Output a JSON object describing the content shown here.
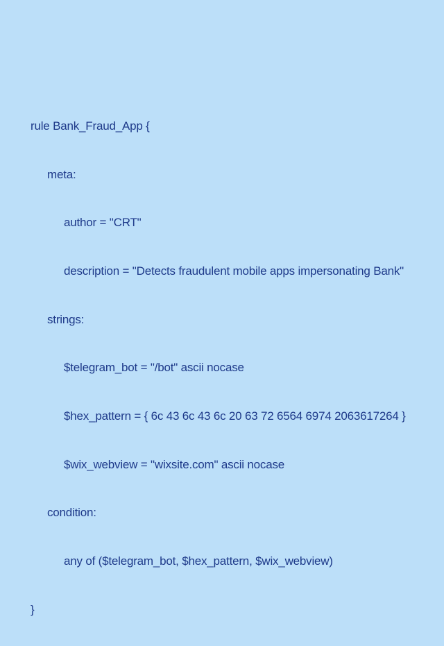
{
  "yara_rule": {
    "rule_keyword": "rule",
    "rule_name": "Bank_Fraud_App",
    "open_brace": "{",
    "meta_section": "meta:",
    "meta_author": "author = \"CRT\"",
    "meta_description": "description = \"Detects fraudulent mobile apps impersonating Bank\"",
    "strings_section": "strings:",
    "string_telegram": "$telegram_bot = \"/bot\" ascii nocase",
    "string_hex": "$hex_pattern = { 6c 43 6c 43 6c 20 63 72 6564 6974 2063617264 }",
    "string_wix": "$wix_webview = \"wixsite.com\" ascii nocase",
    "condition_section": "condition:",
    "condition_expr": "any of ($telegram_bot, $hex_pattern, $wix_webview)",
    "close_brace": "}"
  }
}
